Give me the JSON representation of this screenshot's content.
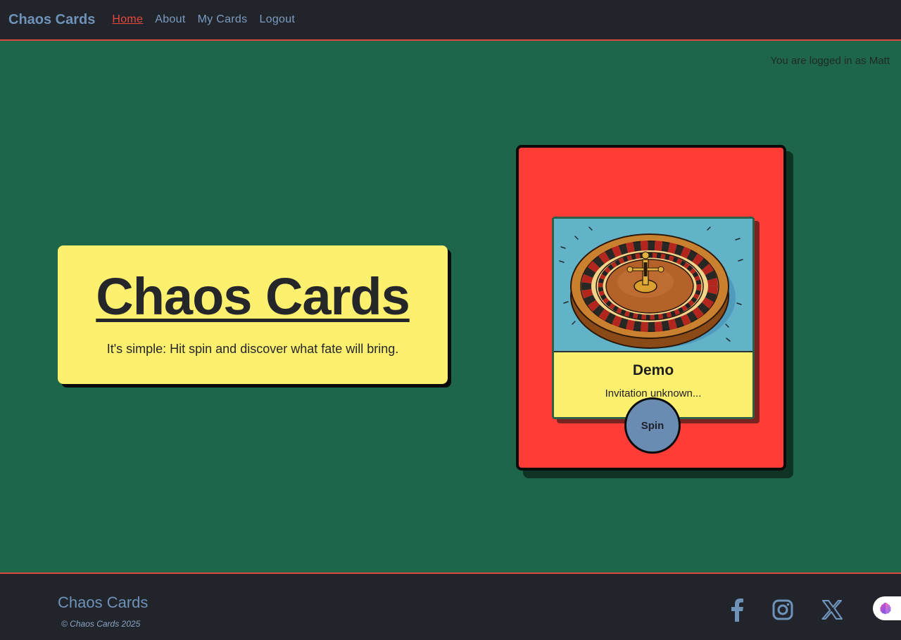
{
  "nav": {
    "brand": "Chaos Cards",
    "links": [
      {
        "label": "Home",
        "active": true
      },
      {
        "label": "About",
        "active": false
      },
      {
        "label": "My Cards",
        "active": false
      },
      {
        "label": "Logout",
        "active": false
      }
    ]
  },
  "status": {
    "logged_in_text": "You are logged in as Matt"
  },
  "hero": {
    "title": "Chaos Cards",
    "subtitle": "It's simple: Hit spin and discover what fate will bring."
  },
  "card": {
    "image_icon": "roulette-wheel-icon",
    "title": "Demo",
    "description": "Invitation unknown...",
    "spin_label": "Spin"
  },
  "footer": {
    "brand": "Chaos Cards",
    "copyright": "© Chaos Cards 2025",
    "social_icons": [
      "facebook-icon",
      "instagram-icon",
      "x-icon"
    ]
  },
  "colors": {
    "background": "#1e6649",
    "navbar": "#21242b",
    "accent": "#e8473c",
    "link": "#7d9cc0",
    "hero_bg": "#fdf06f",
    "panel_bg": "#ff3d36",
    "spin_button": "#6b8cb2"
  }
}
